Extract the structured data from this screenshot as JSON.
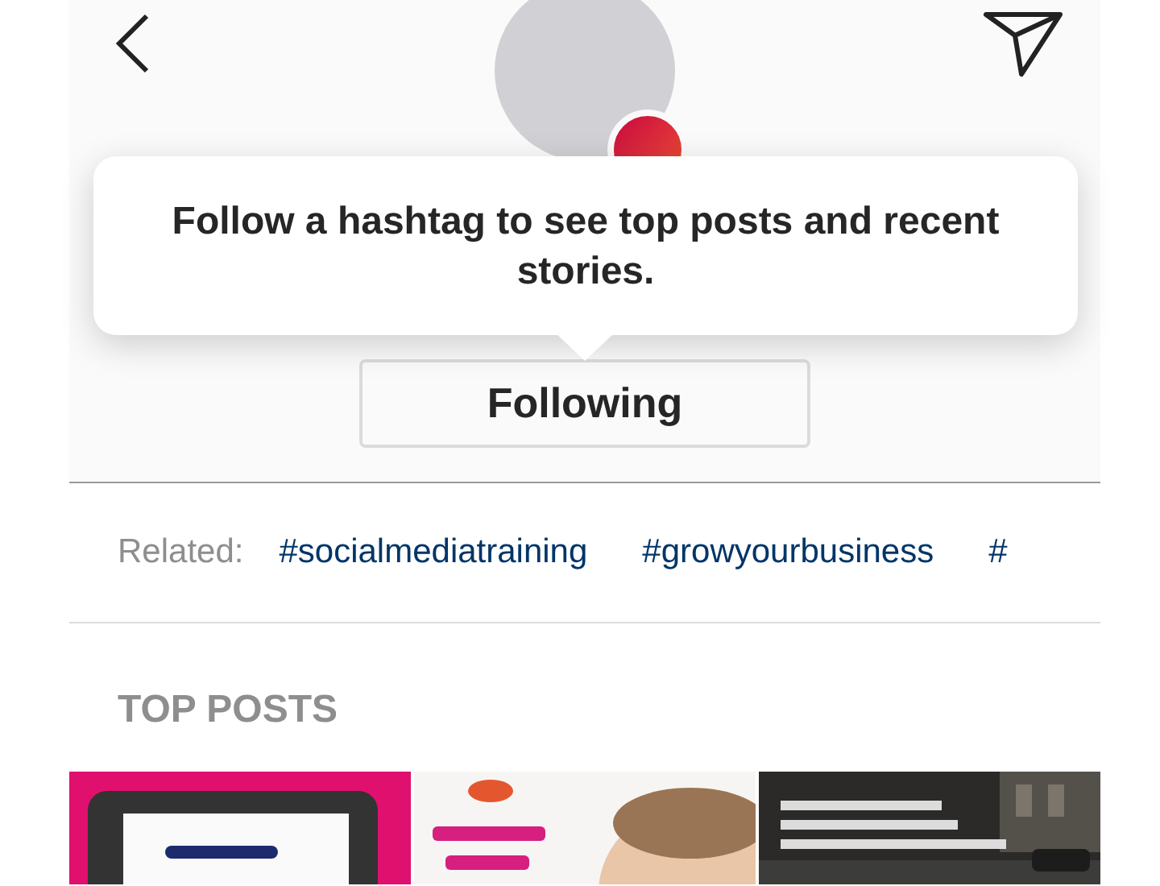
{
  "tooltip": {
    "text": "Follow a hashtag to see top posts and recent stories."
  },
  "follow_button": {
    "label": "Following"
  },
  "related": {
    "label": "Related:",
    "tags": [
      "#socialmediatraining",
      "#growyourbusiness",
      "#"
    ]
  },
  "top_posts": {
    "title": "TOP POSTS"
  }
}
